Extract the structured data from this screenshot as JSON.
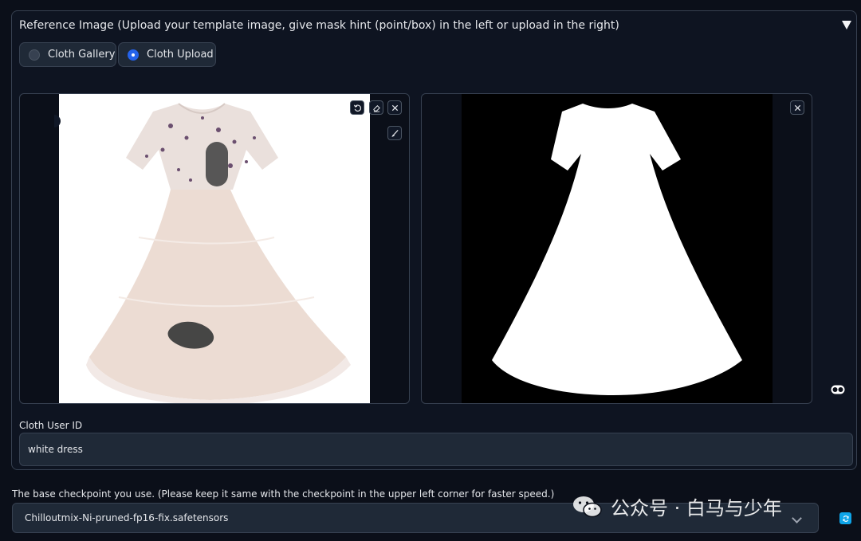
{
  "panel": {
    "title": "Reference Image (Upload your template image, give mask hint (point/box) in the left or upload in the right)"
  },
  "source_select": {
    "options": [
      {
        "label": "Cloth Gallery",
        "selected": false
      },
      {
        "label": "Cloth Upload",
        "selected": true
      }
    ]
  },
  "icons": {
    "collapse": "triangle-down-icon",
    "undo": "undo-icon",
    "eraser": "eraser-icon",
    "clear": "close-icon",
    "brush": "brush-icon",
    "refresh": "refresh-icon"
  },
  "cloth_user_id": {
    "label": "Cloth User ID",
    "value": "white dress"
  },
  "checkpoint": {
    "label": "The base checkpoint you use. (Please keep it same with the checkpoint in the upper left corner for faster speed.)",
    "value": "Chilloutmix-Ni-pruned-fp16-fix.safetensors"
  },
  "watermark": {
    "text": "公众号 · 白马与少年"
  },
  "colors": {
    "background": "#0b0f19",
    "panel": "#0e1421",
    "border": "#374151",
    "input": "#1f2937",
    "accent": "#2563eb"
  }
}
